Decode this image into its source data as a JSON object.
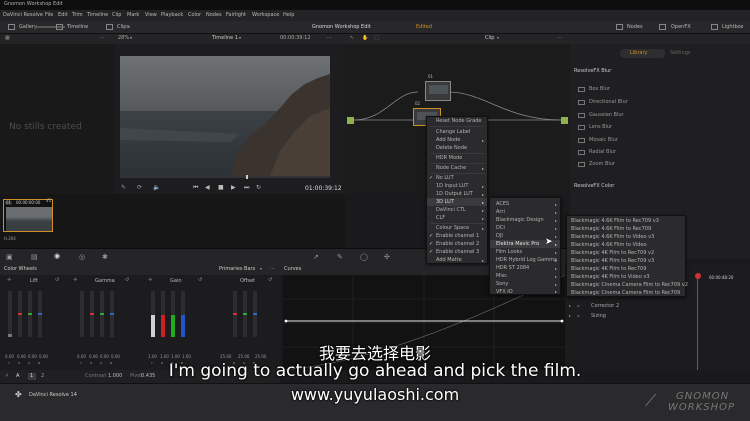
{
  "window_title": "Gnomon Workshop Edit",
  "menu": [
    "DaVinci Resolve",
    "File",
    "Edit",
    "Trim",
    "Timeline",
    "Clip",
    "Mark",
    "View",
    "Playback",
    "Color",
    "Nodes",
    "Fairlight",
    "Workspace",
    "Help"
  ],
  "toolbar": {
    "gallery": "Gallery",
    "timeline": "Timeline",
    "clips": "Clips",
    "project_title": "Gnomon Workshop Edit",
    "project_status": "Edited",
    "nodes": "Nodes",
    "openfx": "OpenFX",
    "lightbox": "Lightbox"
  },
  "viewer": {
    "zoom": "28%",
    "timeline_name": "Timeline 1",
    "timecode_top": "00:00:39:12",
    "timecode": "01:00:39:12",
    "clip_label": "Clip"
  },
  "gallery": {
    "empty_text": "No stills created"
  },
  "timeline": {
    "clip_id": "01",
    "clip_tc": "00:00:00:00",
    "track": "V1",
    "codec": "H.264"
  },
  "nodes": {
    "node1": "01",
    "node2": "02"
  },
  "fx": {
    "tabs": [
      "Library",
      "Settings"
    ],
    "section1": "ResolveFX Blur",
    "items": [
      "Box Blur",
      "Directional Blur",
      "Gaussian Blur",
      "Lens Blur",
      "Mosaic Blur",
      "Radial Blur",
      "Zoom Blur"
    ],
    "section2": "ResolveFX Color"
  },
  "context_menu": {
    "items": [
      "Reset Node Grade",
      "Change Label",
      "Add Node",
      "Delete Node",
      "HDR Mode",
      "Node Cache",
      "No LUT",
      "1D Input LUT",
      "1D Output LUT",
      "3D LUT",
      "DaVinci CTL",
      "CLF",
      "Colour Space",
      "Enable channel 1",
      "Enable channel 2",
      "Enable channel 3",
      "Add Matte"
    ]
  },
  "lut_menu": {
    "items": [
      "ACES",
      "Arri",
      "Blackmagic Design",
      "DCI",
      "DJI",
      "Elektra Mavic Pro",
      "Film Looks",
      "HDR Hybrid Log Gamma",
      "HDR ST 2084",
      "Misc",
      "Sony",
      "VFX IO"
    ]
  },
  "film_menu": {
    "items": [
      "Blackmagic 4.6K Film to Rec709 v3",
      "Blackmagic 4.6K Film to Rec709",
      "Blackmagic 4.6K Film to Video v3",
      "Blackmagic 4.6K Film to Video",
      "Blackmagic 4K Film to Rec709 v2",
      "Blackmagic 4K Film to Rec709 v3",
      "Blackmagic 4K Film to Rec709",
      "Blackmagic 4K Film to Video v3",
      "Blackmagic Cinema Camera Film to Rec709 v2",
      "Blackmagic Cinema Camera Film to Rec709"
    ]
  },
  "color_wheels": {
    "title": "Color Wheels",
    "mode": "Primaries Bars",
    "wheels": [
      "Lift",
      "Gamma",
      "Gain",
      "Offset"
    ],
    "values": {
      "lift": [
        "0.00",
        "0.00",
        "0.00",
        "0.00"
      ],
      "gamma": [
        "0.00",
        "0.00",
        "0.00",
        "0.00"
      ],
      "gain": [
        "1.00",
        "1.00",
        "1.00",
        "1.00"
      ],
      "offset": [
        "25.00",
        "25.00",
        "25.00"
      ]
    },
    "channel_labels": [
      "Y",
      "R",
      "G",
      "B"
    ],
    "contrast_label": "Contrast",
    "contrast": "1.000",
    "pivot_label": "Pivot",
    "pivot": "0.435",
    "pages": [
      "1",
      "2"
    ]
  },
  "curves": {
    "title": "Curves"
  },
  "node_list": {
    "items": [
      "Corrector 2",
      "Sizing"
    ],
    "tc": "00:00:48:20"
  },
  "footer": {
    "app": "DaVinci Resolve 14"
  },
  "subtitles": {
    "chinese": "我要去选择电影",
    "english": "I'm going to actually go ahead and pick the film.",
    "website": "www.yuyulaoshi.com"
  },
  "watermark": {
    "line1": "GNOMON",
    "line2": "WORKSHOP"
  },
  "colors": {
    "accent": "#e3a11b",
    "status_edited": "#d08f24",
    "node_green": "#8fb04a"
  }
}
